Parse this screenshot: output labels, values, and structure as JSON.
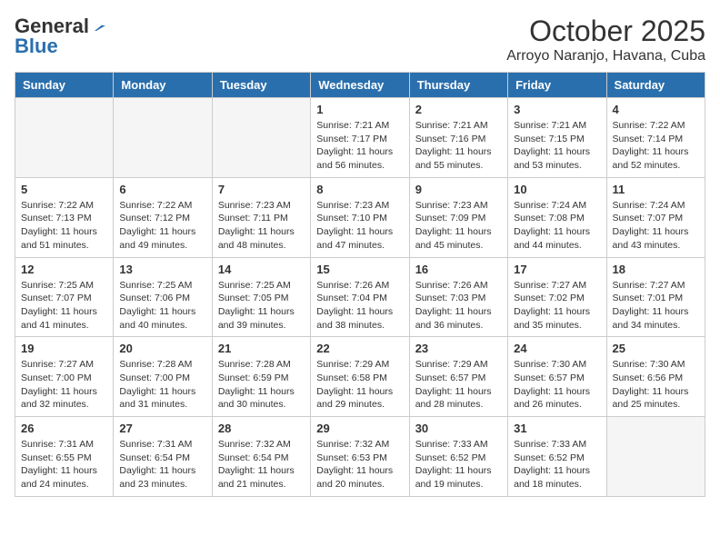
{
  "logo": {
    "general": "General",
    "blue": "Blue"
  },
  "title": "October 2025",
  "location": "Arroyo Naranjo, Havana, Cuba",
  "weekdays": [
    "Sunday",
    "Monday",
    "Tuesday",
    "Wednesday",
    "Thursday",
    "Friday",
    "Saturday"
  ],
  "weeks": [
    [
      {
        "day": "",
        "info": ""
      },
      {
        "day": "",
        "info": ""
      },
      {
        "day": "",
        "info": ""
      },
      {
        "day": "1",
        "info": "Sunrise: 7:21 AM\nSunset: 7:17 PM\nDaylight: 11 hours\nand 56 minutes."
      },
      {
        "day": "2",
        "info": "Sunrise: 7:21 AM\nSunset: 7:16 PM\nDaylight: 11 hours\nand 55 minutes."
      },
      {
        "day": "3",
        "info": "Sunrise: 7:21 AM\nSunset: 7:15 PM\nDaylight: 11 hours\nand 53 minutes."
      },
      {
        "day": "4",
        "info": "Sunrise: 7:22 AM\nSunset: 7:14 PM\nDaylight: 11 hours\nand 52 minutes."
      }
    ],
    [
      {
        "day": "5",
        "info": "Sunrise: 7:22 AM\nSunset: 7:13 PM\nDaylight: 11 hours\nand 51 minutes."
      },
      {
        "day": "6",
        "info": "Sunrise: 7:22 AM\nSunset: 7:12 PM\nDaylight: 11 hours\nand 49 minutes."
      },
      {
        "day": "7",
        "info": "Sunrise: 7:23 AM\nSunset: 7:11 PM\nDaylight: 11 hours\nand 48 minutes."
      },
      {
        "day": "8",
        "info": "Sunrise: 7:23 AM\nSunset: 7:10 PM\nDaylight: 11 hours\nand 47 minutes."
      },
      {
        "day": "9",
        "info": "Sunrise: 7:23 AM\nSunset: 7:09 PM\nDaylight: 11 hours\nand 45 minutes."
      },
      {
        "day": "10",
        "info": "Sunrise: 7:24 AM\nSunset: 7:08 PM\nDaylight: 11 hours\nand 44 minutes."
      },
      {
        "day": "11",
        "info": "Sunrise: 7:24 AM\nSunset: 7:07 PM\nDaylight: 11 hours\nand 43 minutes."
      }
    ],
    [
      {
        "day": "12",
        "info": "Sunrise: 7:25 AM\nSunset: 7:07 PM\nDaylight: 11 hours\nand 41 minutes."
      },
      {
        "day": "13",
        "info": "Sunrise: 7:25 AM\nSunset: 7:06 PM\nDaylight: 11 hours\nand 40 minutes."
      },
      {
        "day": "14",
        "info": "Sunrise: 7:25 AM\nSunset: 7:05 PM\nDaylight: 11 hours\nand 39 minutes."
      },
      {
        "day": "15",
        "info": "Sunrise: 7:26 AM\nSunset: 7:04 PM\nDaylight: 11 hours\nand 38 minutes."
      },
      {
        "day": "16",
        "info": "Sunrise: 7:26 AM\nSunset: 7:03 PM\nDaylight: 11 hours\nand 36 minutes."
      },
      {
        "day": "17",
        "info": "Sunrise: 7:27 AM\nSunset: 7:02 PM\nDaylight: 11 hours\nand 35 minutes."
      },
      {
        "day": "18",
        "info": "Sunrise: 7:27 AM\nSunset: 7:01 PM\nDaylight: 11 hours\nand 34 minutes."
      }
    ],
    [
      {
        "day": "19",
        "info": "Sunrise: 7:27 AM\nSunset: 7:00 PM\nDaylight: 11 hours\nand 32 minutes."
      },
      {
        "day": "20",
        "info": "Sunrise: 7:28 AM\nSunset: 7:00 PM\nDaylight: 11 hours\nand 31 minutes."
      },
      {
        "day": "21",
        "info": "Sunrise: 7:28 AM\nSunset: 6:59 PM\nDaylight: 11 hours\nand 30 minutes."
      },
      {
        "day": "22",
        "info": "Sunrise: 7:29 AM\nSunset: 6:58 PM\nDaylight: 11 hours\nand 29 minutes."
      },
      {
        "day": "23",
        "info": "Sunrise: 7:29 AM\nSunset: 6:57 PM\nDaylight: 11 hours\nand 28 minutes."
      },
      {
        "day": "24",
        "info": "Sunrise: 7:30 AM\nSunset: 6:57 PM\nDaylight: 11 hours\nand 26 minutes."
      },
      {
        "day": "25",
        "info": "Sunrise: 7:30 AM\nSunset: 6:56 PM\nDaylight: 11 hours\nand 25 minutes."
      }
    ],
    [
      {
        "day": "26",
        "info": "Sunrise: 7:31 AM\nSunset: 6:55 PM\nDaylight: 11 hours\nand 24 minutes."
      },
      {
        "day": "27",
        "info": "Sunrise: 7:31 AM\nSunset: 6:54 PM\nDaylight: 11 hours\nand 23 minutes."
      },
      {
        "day": "28",
        "info": "Sunrise: 7:32 AM\nSunset: 6:54 PM\nDaylight: 11 hours\nand 21 minutes."
      },
      {
        "day": "29",
        "info": "Sunrise: 7:32 AM\nSunset: 6:53 PM\nDaylight: 11 hours\nand 20 minutes."
      },
      {
        "day": "30",
        "info": "Sunrise: 7:33 AM\nSunset: 6:52 PM\nDaylight: 11 hours\nand 19 minutes."
      },
      {
        "day": "31",
        "info": "Sunrise: 7:33 AM\nSunset: 6:52 PM\nDaylight: 11 hours\nand 18 minutes."
      },
      {
        "day": "",
        "info": ""
      }
    ]
  ]
}
